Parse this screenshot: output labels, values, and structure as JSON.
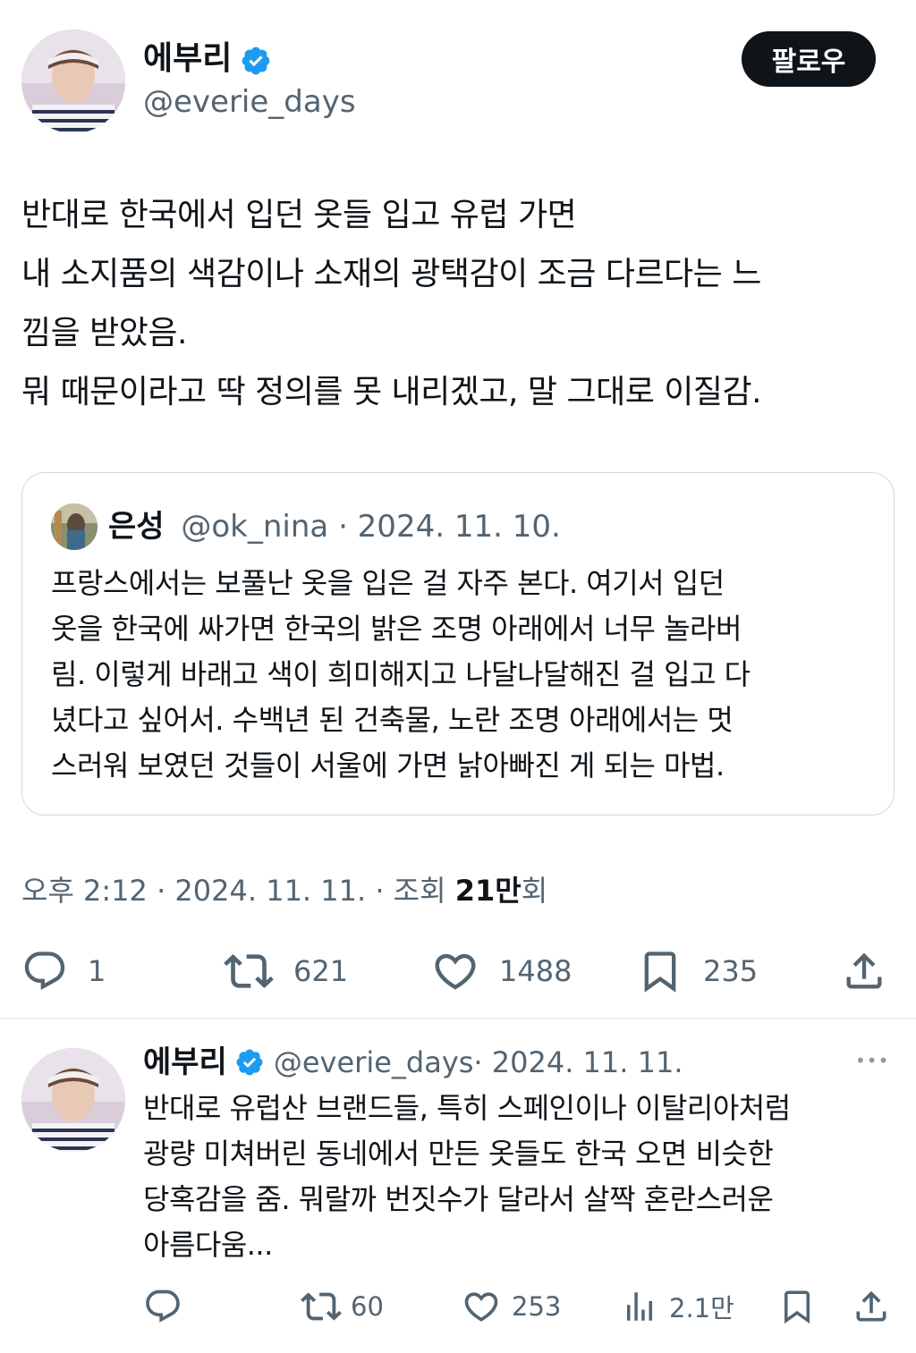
{
  "main_tweet": {
    "author_name": "에부리",
    "author_handle": "@everie_days",
    "follow_label": "팔로우",
    "text_lines": [
      "반대로 한국에서 입던 옷들 입고 유럽 가면",
      "내 소지품의 색감이나 소재의 광택감이 조금 다르다는 느",
      "낌을 받았음.",
      "뭐 때문이라고 딱 정의를 못 내리겠고, 말 그대로 이질감."
    ],
    "quote": {
      "author_name": "은성",
      "author_handle": "@ok_nina",
      "date": "· 2024. 11. 10.",
      "text_lines": [
        "프랑스에서는 보풀난 옷을 입은 걸 자주 본다. 여기서 입던",
        "옷을 한국에 싸가면 한국의 밝은 조명 아래에서 너무 놀라버",
        "림. 이렇게 바래고 색이 희미해지고 나달나달해진 걸 입고 다",
        "녔다고 싶어서. 수백년 된 건축물, 노란 조명 아래에서는 멋",
        "스러워 보였던 것들이 서울에 가면 낡아빠진 게 되는 마법."
      ]
    },
    "timestamp": "오후 2:12 · 2024. 11. 11. · 조회 ",
    "views_bold": "21만",
    "views_suffix": "회",
    "actions": {
      "replies": "1",
      "retweets": "621",
      "likes": "1488",
      "bookmarks": "235"
    }
  },
  "reply_tweet": {
    "author_name": "에부리",
    "author_handle": "@everie_days",
    "date": "· 2024. 11. 11.",
    "more_label": "•••",
    "text_lines": [
      "반대로 유럽산 브랜드들, 특히 스페인이나 이탈리아처럼",
      "광량 미쳐버린 동네에서 만든 옷들도 한국 오면 비슷한",
      "당혹감을 줌. 뭐랄까 번짓수가 달라서 살짝 혼란스러운",
      "아름다움..."
    ],
    "actions": {
      "retweets": "60",
      "likes": "253",
      "views": "2.1만"
    }
  },
  "colors": {
    "verified": "#1d9bf0",
    "secondary_text": "#536471",
    "border": "#cfd9de"
  },
  "icons": [
    "verified-badge-icon",
    "reply-icon",
    "retweet-icon",
    "like-icon",
    "bookmark-icon",
    "share-icon",
    "views-icon",
    "more-icon"
  ]
}
